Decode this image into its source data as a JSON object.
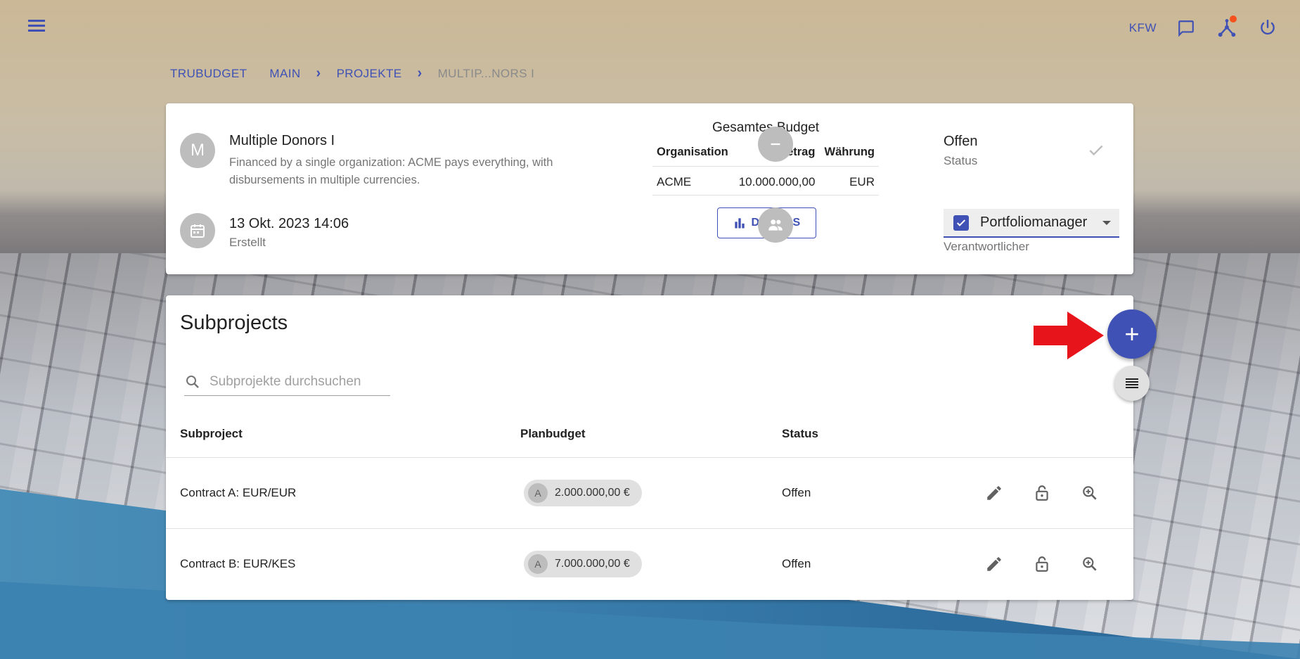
{
  "topbar": {
    "org": "KFW",
    "icons": [
      "menu-icon",
      "chat-icon",
      "network-icon",
      "power-icon"
    ],
    "notification_dot_color": "#f4511e"
  },
  "breadcrumb": {
    "items": [
      "TRUBUDGET",
      "MAIN",
      "PROJEKTE",
      "MULTIP...NORS I"
    ]
  },
  "project": {
    "avatar_letter": "M",
    "title": "Multiple Donors I",
    "description": "Financed by a single organization: ACME pays everything, with disbursements in multiple currencies.",
    "created_date": "13 Okt. 2023 14:06",
    "created_label": "Erstellt"
  },
  "budget": {
    "title": "Gesamtes Budget",
    "headers": [
      "Organisation",
      "Betrag",
      "Währung"
    ],
    "rows": [
      {
        "organisation": "ACME",
        "amount": "10.000.000,00",
        "currency": "EUR"
      }
    ],
    "details_label": "DETAILS"
  },
  "status": {
    "value": "Offen",
    "label": "Status"
  },
  "responsible": {
    "value": "Portfoliomanager",
    "label": "Verantwortlicher"
  },
  "subprojects": {
    "title": "Subprojects",
    "search_placeholder": "Subprojekte durchsuchen",
    "columns": [
      "Subproject",
      "Planbudget",
      "Status"
    ],
    "rows": [
      {
        "name": "Contract A: EUR/EUR",
        "chip_letter": "A",
        "budget": "2.000.000,00 €",
        "status": "Offen"
      },
      {
        "name": "Contract B: EUR/KES",
        "chip_letter": "A",
        "budget": "7.000.000,00 €",
        "status": "Offen"
      }
    ]
  },
  "colors": {
    "primary": "#3f51b5",
    "arrow": "#e8141c"
  }
}
